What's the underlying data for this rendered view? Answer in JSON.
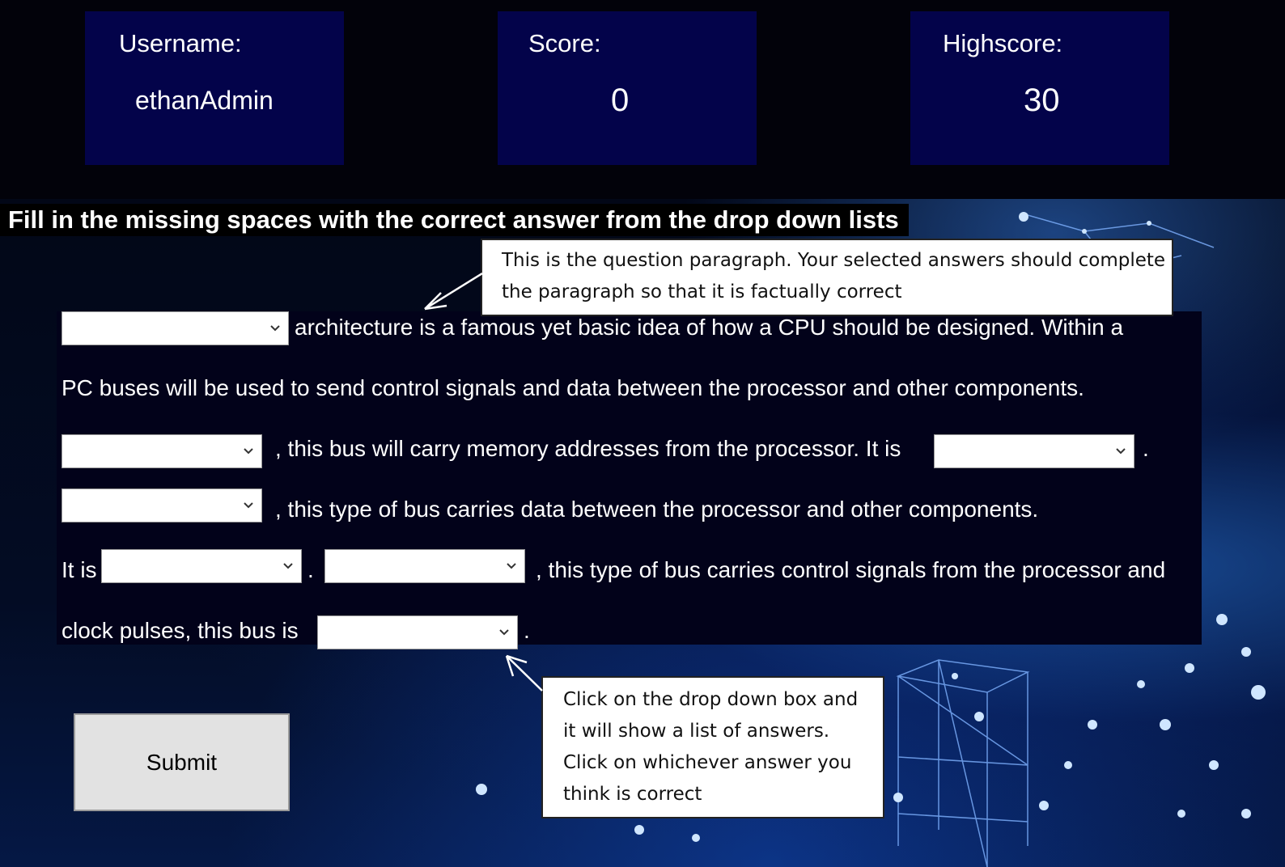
{
  "stats": {
    "username_label": "Username:",
    "username_value": "ethanAdmin",
    "score_label": "Score:",
    "score_value": "0",
    "highscore_label": "Highscore:",
    "highscore_value": "30"
  },
  "instruction": "Fill in the missing spaces with the correct answer from the drop down lists",
  "paragraph": {
    "l1_text": "architecture is a famous yet basic idea of how a CPU should be designed. Within a",
    "l2_text": "PC buses will be used to send control signals and data between the processor and other components.",
    "l3_text": ", this bus will carry memory addresses from the processor. It is",
    "l3_end": ".",
    "l4_text": ", this type of bus carries data between the processor and other components.",
    "l5_start": "It is",
    "l5_dot": ".",
    "l5_text": ", this type of bus carries control signals from the processor and",
    "l6_text": "clock pulses, this bus is",
    "l6_end": "."
  },
  "dropdowns": [
    "",
    "",
    "",
    "",
    "",
    "",
    ""
  ],
  "callouts": {
    "paragraph_note": [
      "This is the question paragraph. Your selected answers should complete",
      "the paragraph so that it is factually correct"
    ],
    "dropdown_note": [
      "Click on the drop down box and",
      "it will show a list of answers.",
      "Click on whichever answer you",
      "think is correct"
    ]
  },
  "submit_label": "Submit",
  "colors": {
    "stat_box": "#03034a",
    "panel": "#02021a",
    "accent_glow": "#2878e6"
  }
}
